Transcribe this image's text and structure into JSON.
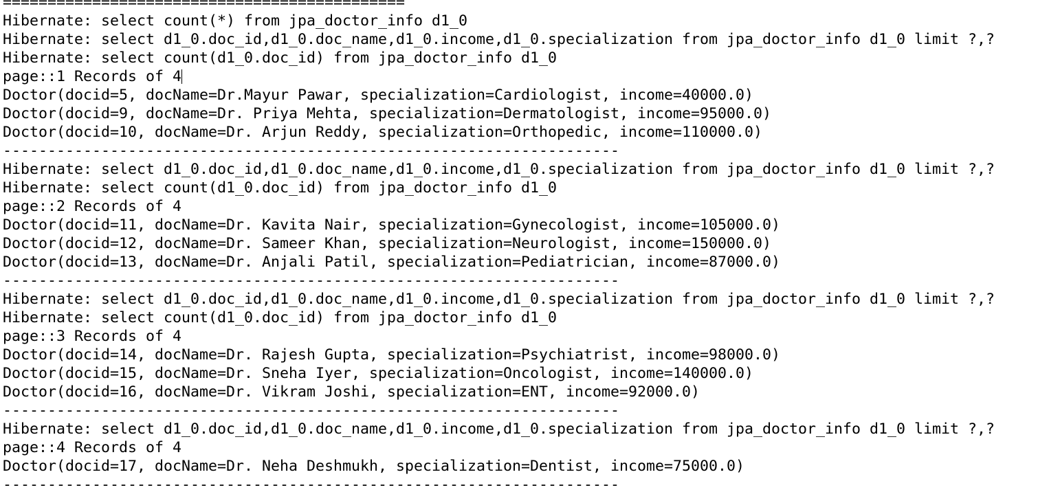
{
  "console": {
    "lines": [
      "=============================================",
      "Hibernate: select count(*) from jpa_doctor_info d1_0",
      "Hibernate: select d1_0.doc_id,d1_0.doc_name,d1_0.income,d1_0.specialization from jpa_doctor_info d1_0 limit ?,?",
      "Hibernate: select count(d1_0.doc_id) from jpa_doctor_info d1_0",
      "page::1 Records of 4",
      "Doctor(docid=5, docName=Dr.Mayur Pawar, specialization=Cardiologist, income=40000.0)",
      "Doctor(docid=9, docName=Dr. Priya Mehta, specialization=Dermatologist, income=95000.0)",
      "Doctor(docid=10, docName=Dr. Arjun Reddy, specialization=Orthopedic, income=110000.0)",
      "---------------------------------------------------------------------",
      "Hibernate: select d1_0.doc_id,d1_0.doc_name,d1_0.income,d1_0.specialization from jpa_doctor_info d1_0 limit ?,?",
      "Hibernate: select count(d1_0.doc_id) from jpa_doctor_info d1_0",
      "page::2 Records of 4",
      "Doctor(docid=11, docName=Dr. Kavita Nair, specialization=Gynecologist, income=105000.0)",
      "Doctor(docid=12, docName=Dr. Sameer Khan, specialization=Neurologist, income=150000.0)",
      "Doctor(docid=13, docName=Dr. Anjali Patil, specialization=Pediatrician, income=87000.0)",
      "---------------------------------------------------------------------",
      "Hibernate: select d1_0.doc_id,d1_0.doc_name,d1_0.income,d1_0.specialization from jpa_doctor_info d1_0 limit ?,?",
      "Hibernate: select count(d1_0.doc_id) from jpa_doctor_info d1_0",
      "page::3 Records of 4",
      "Doctor(docid=14, docName=Dr. Rajesh Gupta, specialization=Psychiatrist, income=98000.0)",
      "Doctor(docid=15, docName=Dr. Sneha Iyer, specialization=Oncologist, income=140000.0)",
      "Doctor(docid=16, docName=Dr. Vikram Joshi, specialization=ENT, income=92000.0)",
      "---------------------------------------------------------------------",
      "Hibernate: select d1_0.doc_id,d1_0.doc_name,d1_0.income,d1_0.specialization from jpa_doctor_info d1_0 limit ?,?",
      "page::4 Records of 4",
      "Doctor(docid=17, docName=Dr. Neha Deshmukh, specialization=Dentist, income=75000.0)",
      "---------------------------------------------------------------------"
    ]
  },
  "colors": {
    "background": "#ffffff",
    "text": "#000000"
  }
}
